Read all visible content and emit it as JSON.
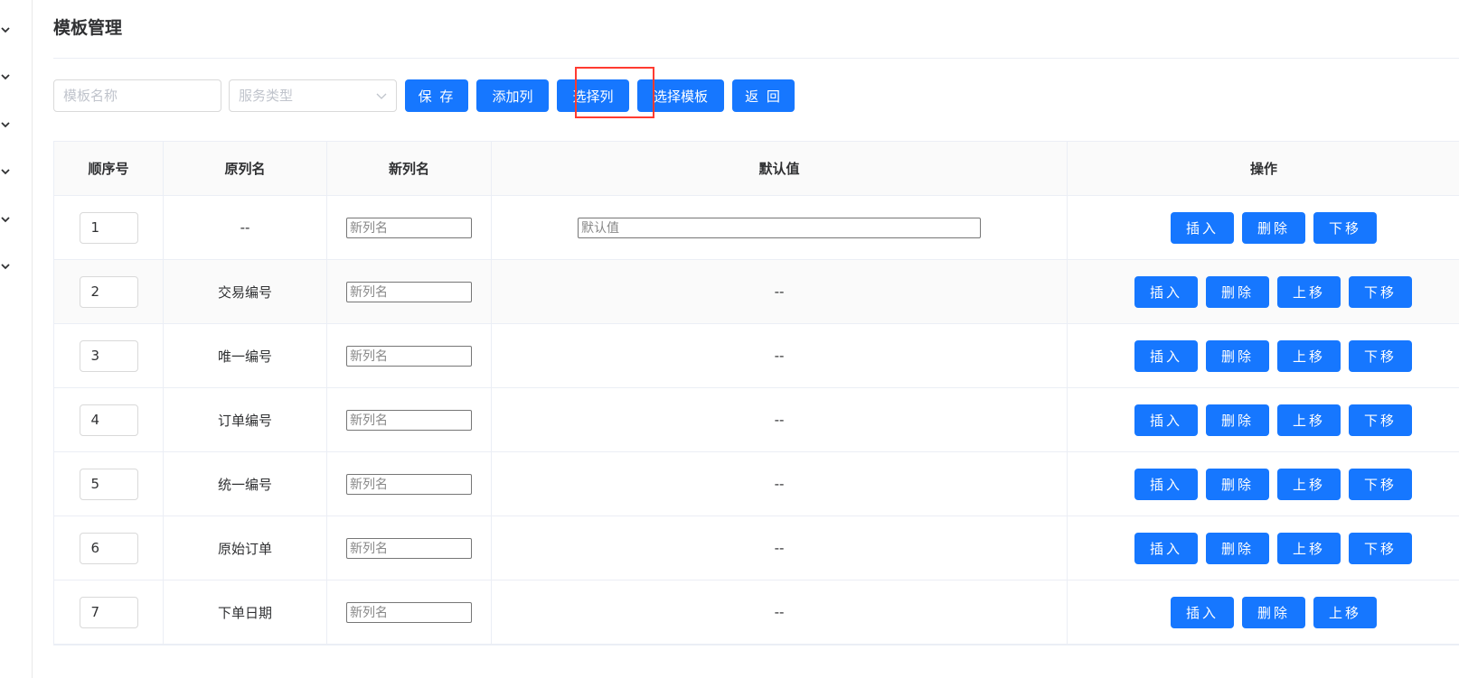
{
  "page": {
    "title": "模板管理"
  },
  "toolbar": {
    "template_name_placeholder": "模板名称",
    "service_type_placeholder": "服务类型",
    "save_label": "保 存",
    "add_column_label": "添加列",
    "select_column_label": "选择列",
    "select_template_label": "选择模板",
    "back_label": "返 回"
  },
  "table": {
    "headers": [
      "顺序号",
      "原列名",
      "新列名",
      "默认值",
      "操作"
    ],
    "new_name_placeholder": "新列名",
    "default_placeholder": "默认值",
    "empty_value": "--",
    "actions": {
      "insert": "插入",
      "delete": "删除",
      "move_up": "上移",
      "move_down": "下移"
    },
    "rows": [
      {
        "seq": "1",
        "original": "--",
        "default": "input"
      },
      {
        "seq": "2",
        "original": "交易编号",
        "default": "--"
      },
      {
        "seq": "3",
        "original": "唯一编号",
        "default": "--"
      },
      {
        "seq": "4",
        "original": "订单编号",
        "default": "--"
      },
      {
        "seq": "5",
        "original": "统一编号",
        "default": "--"
      },
      {
        "seq": "6",
        "original": "原始订单",
        "default": "--"
      },
      {
        "seq": "7",
        "original": "下单日期",
        "default": "--"
      }
    ]
  },
  "highlight": {
    "target": "select-column-button",
    "color": "#ff3b30"
  },
  "colors": {
    "primary": "#1677ff",
    "border": "#ebeef5"
  }
}
